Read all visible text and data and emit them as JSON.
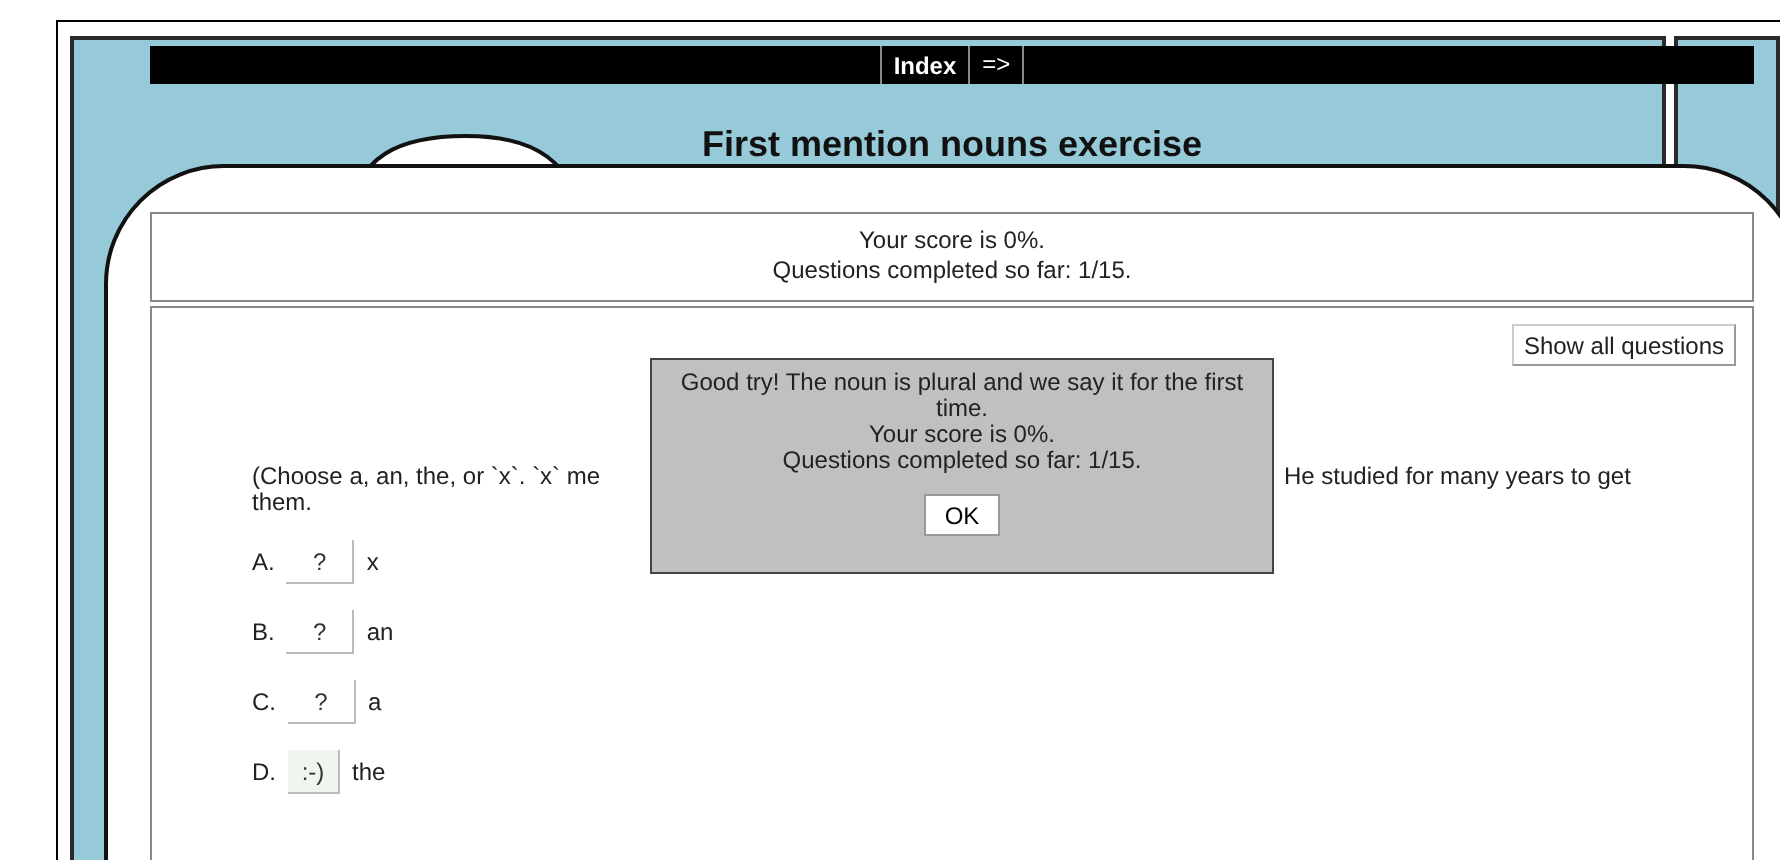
{
  "nav": {
    "index_button": "Index",
    "next_link": "=>"
  },
  "title": "First mention nouns exercise",
  "score": {
    "line_1": "Your score is 0%.",
    "line_2": "Questions completed so far: 1/15."
  },
  "show_all_button": "Show all questions",
  "question": {
    "text_left": "(Choose a, an, the, or `x`. `x` me",
    "text_right": "He studied for many years to get",
    "text_line_2": "them."
  },
  "options": [
    {
      "letter": "A.",
      "answer": "?",
      "word": "x",
      "selected": false
    },
    {
      "letter": "B.",
      "answer": "?",
      "word": "an",
      "selected": false
    },
    {
      "letter": "C.",
      "answer": "?",
      "word": "a",
      "selected": false
    },
    {
      "letter": "D.",
      "answer": ":-)",
      "word": "the",
      "selected": true
    }
  ],
  "dialog": {
    "message": "Good try! The noun is plural and we say it for the first time.",
    "score": "Your score is 0%.",
    "progress": "Questions completed so far: 1/15.",
    "ok_button": "OK"
  }
}
